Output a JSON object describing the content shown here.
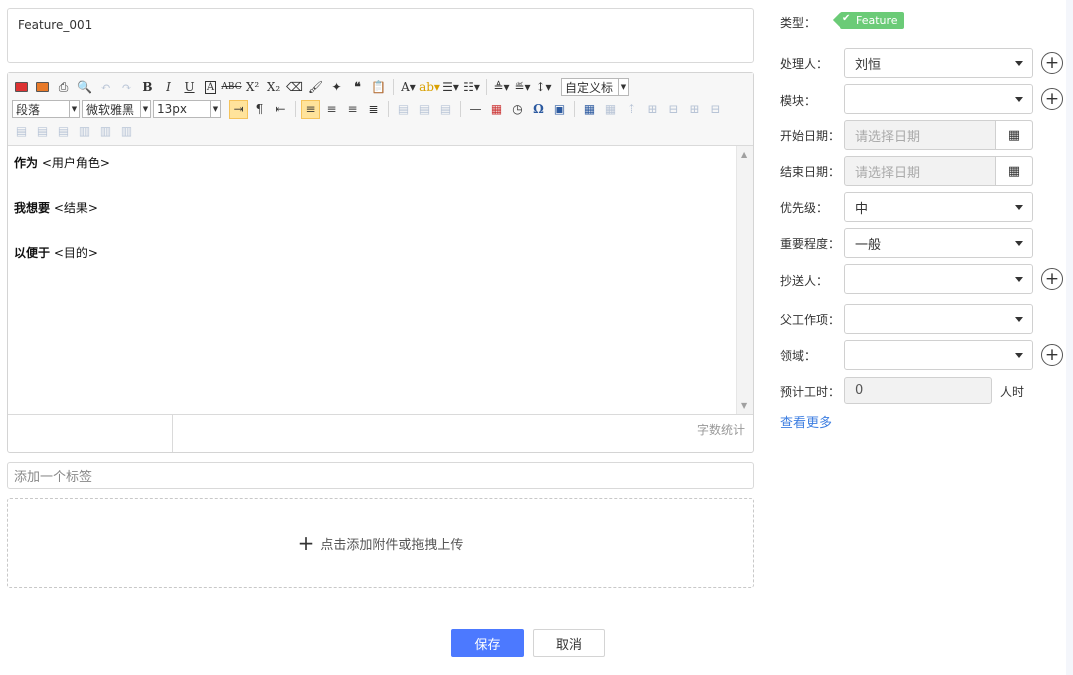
{
  "title_field": {
    "value": "Feature_001"
  },
  "toolbar": {
    "paragraph": "段落",
    "font": "微软雅黑",
    "size": "13px",
    "custom_title": "自定义标"
  },
  "content": {
    "line1_bold": "作为",
    "line1_text": " <用户角色>",
    "line2_bold": "我想要",
    "line2_text": " <结果>",
    "line3_bold": "以便于",
    "line3_text": " <目的>"
  },
  "statusbar": {
    "word_count": "字数统计"
  },
  "tag_input": {
    "placeholder": "添加一个标签"
  },
  "upload": {
    "label": "点击添加附件或拖拽上传"
  },
  "buttons": {
    "save": "保存",
    "cancel": "取消"
  },
  "fields": {
    "type_label": "类型：",
    "type_value": "Feature",
    "assignee_label": "处理人：",
    "assignee_value": "刘恒",
    "module_label": "模块：",
    "module_value": "",
    "start_label": "开始日期：",
    "start_placeholder": "请选择日期",
    "end_label": "结束日期：",
    "end_placeholder": "请选择日期",
    "priority_label": "优先级：",
    "priority_value": "中",
    "importance_label": "重要程度：",
    "importance_value": "一般",
    "cc_label": "抄送人：",
    "cc_value": "",
    "parent_label": "父工作项：",
    "parent_value": "",
    "domain_label": "领域：",
    "domain_value": "",
    "hours_label": "预计工时：",
    "hours_value": "0",
    "hours_unit": "人时",
    "more": "查看更多"
  },
  "colors": {
    "primary": "#4c79ff",
    "badge": "#6bcb77",
    "link": "#3d7ee1"
  }
}
